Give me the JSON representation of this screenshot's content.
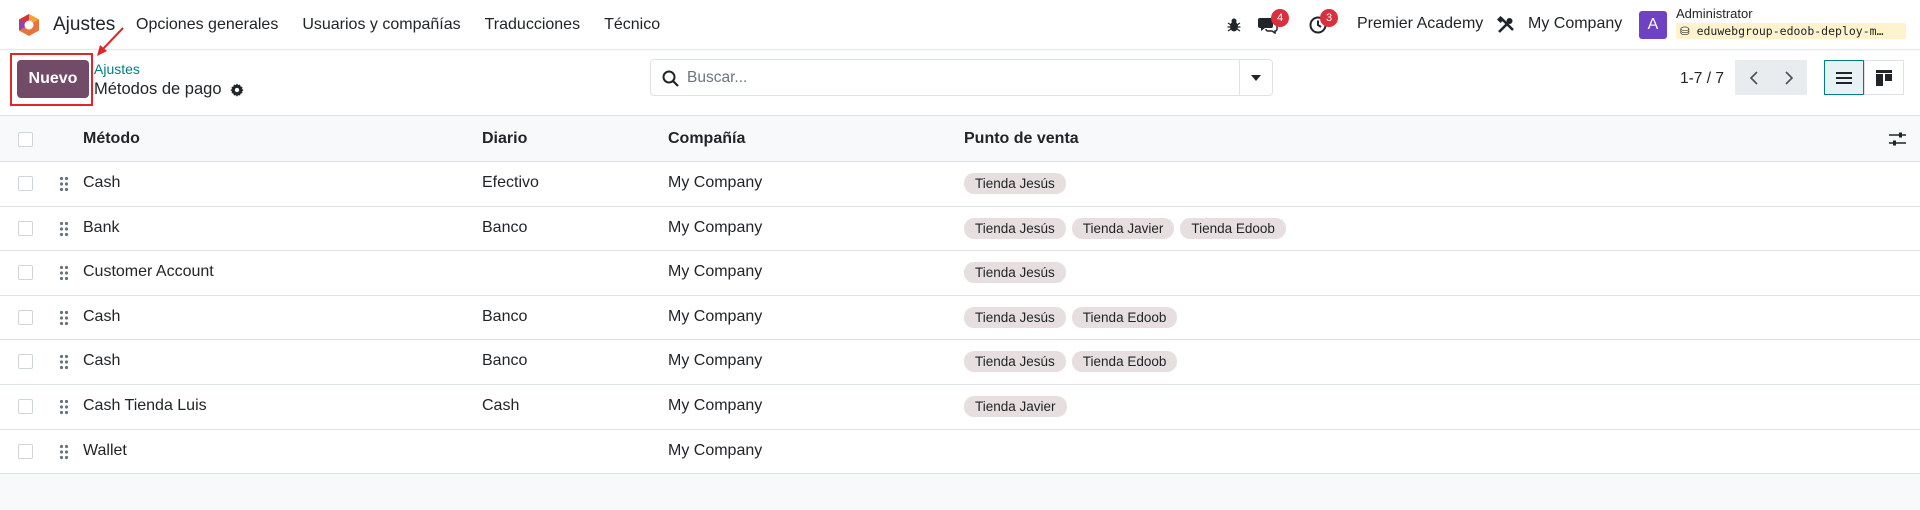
{
  "app": {
    "name": "Ajustes"
  },
  "menu": [
    "Opciones generales",
    "Usuarios y compañías",
    "Traducciones",
    "Técnico"
  ],
  "systray": {
    "messages_count": "4",
    "activities_count": "3",
    "website": "Premier Academy",
    "company": "My Company",
    "avatar_letter": "A",
    "user_name": "Administrator",
    "db_name": "eduwebgroup-edoob-deploy-m…"
  },
  "control": {
    "new_label": "Nuevo",
    "breadcrumb": "Ajustes",
    "title": "Métodos de pago",
    "search_placeholder": "Buscar...",
    "pager": "1-7 / 7"
  },
  "table": {
    "headers": [
      "Método",
      "Diario",
      "Compañía",
      "Punto de venta"
    ],
    "rows": [
      {
        "metodo": "Cash",
        "diario": "Efectivo",
        "compania": "My Company",
        "pos": [
          "Tienda Jesús"
        ]
      },
      {
        "metodo": "Bank",
        "diario": "Banco",
        "compania": "My Company",
        "pos": [
          "Tienda Jesús",
          "Tienda Javier",
          "Tienda Edoob"
        ]
      },
      {
        "metodo": "Customer Account",
        "diario": "",
        "compania": "My Company",
        "pos": [
          "Tienda Jesús"
        ]
      },
      {
        "metodo": "Cash",
        "diario": "Banco",
        "compania": "My Company",
        "pos": [
          "Tienda Jesús",
          "Tienda Edoob"
        ]
      },
      {
        "metodo": "Cash",
        "diario": "Banco",
        "compania": "My Company",
        "pos": [
          "Tienda Jesús",
          "Tienda Edoob"
        ]
      },
      {
        "metodo": "Cash Tienda Luis",
        "diario": "Cash",
        "compania": "My Company",
        "pos": [
          "Tienda Javier"
        ]
      },
      {
        "metodo": "Wallet",
        "diario": "",
        "compania": "My Company",
        "pos": []
      }
    ]
  },
  "colors": {
    "primary": "#714b67",
    "accent": "#017e84",
    "badge": "#d9303e",
    "highlight": "#e0262b"
  }
}
